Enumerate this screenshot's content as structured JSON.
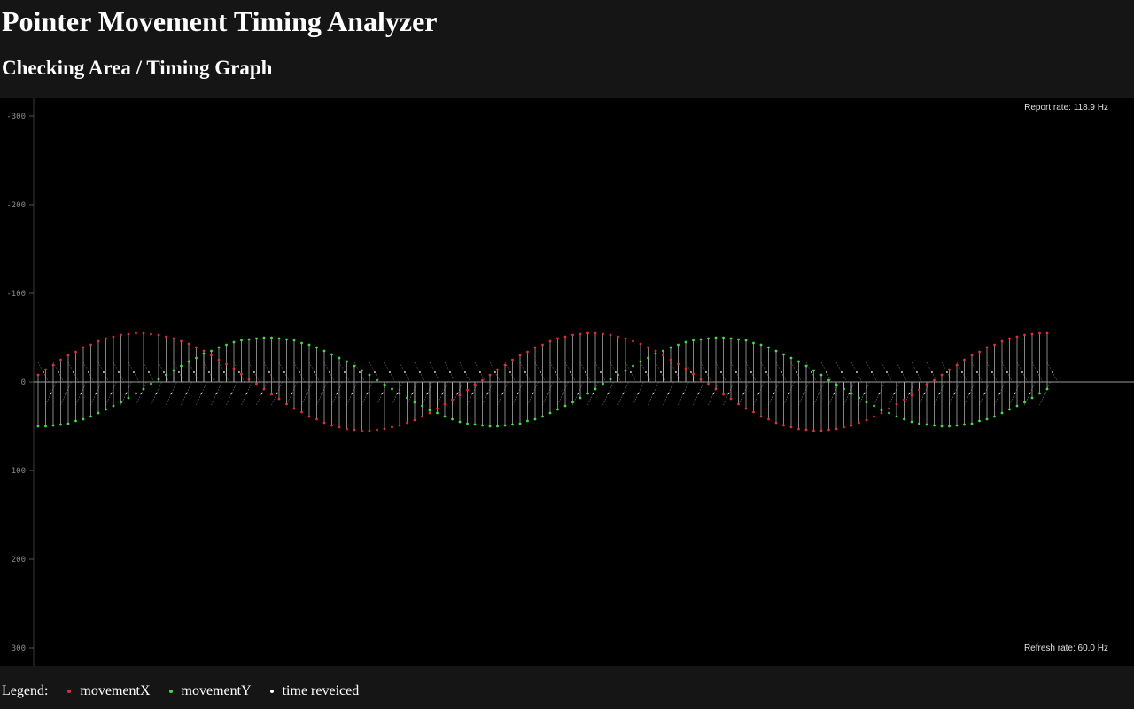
{
  "header": {
    "title": "Pointer Movement Timing Analyzer",
    "section": "Checking Area / Timing Graph"
  },
  "graph": {
    "report_rate": "Report rate: 118.9 Hz",
    "refresh_rate": "Refresh rate: 60.0 Hz"
  },
  "legend": {
    "title": "Legend:",
    "items": [
      {
        "label": "movementX",
        "color": "#e03030"
      },
      {
        "label": "movementY",
        "color": "#44dd44"
      },
      {
        "label": "time reveiced",
        "color": "#ffffff"
      }
    ]
  },
  "chart_data": {
    "type": "scatter",
    "title": "",
    "xlabel": "",
    "ylabel": "",
    "ylim": [
      300,
      -300
    ],
    "y_ticks": [
      "-300",
      "-200",
      "-100",
      "0",
      "100",
      "200",
      "300"
    ],
    "grid": false,
    "sample_count": 135,
    "series": [
      {
        "name": "movementX",
        "color": "#e03030",
        "description": "sinusoidal, amplitude ~55, period ~60 samples, starts near 0 rising toward +50"
      },
      {
        "name": "movementY",
        "color": "#44dd44",
        "description": "sinusoidal, amplitude ~50, period ~60 samples, starts near -48"
      },
      {
        "name": "time reveiced",
        "color": "#ffffff"
      }
    ]
  }
}
